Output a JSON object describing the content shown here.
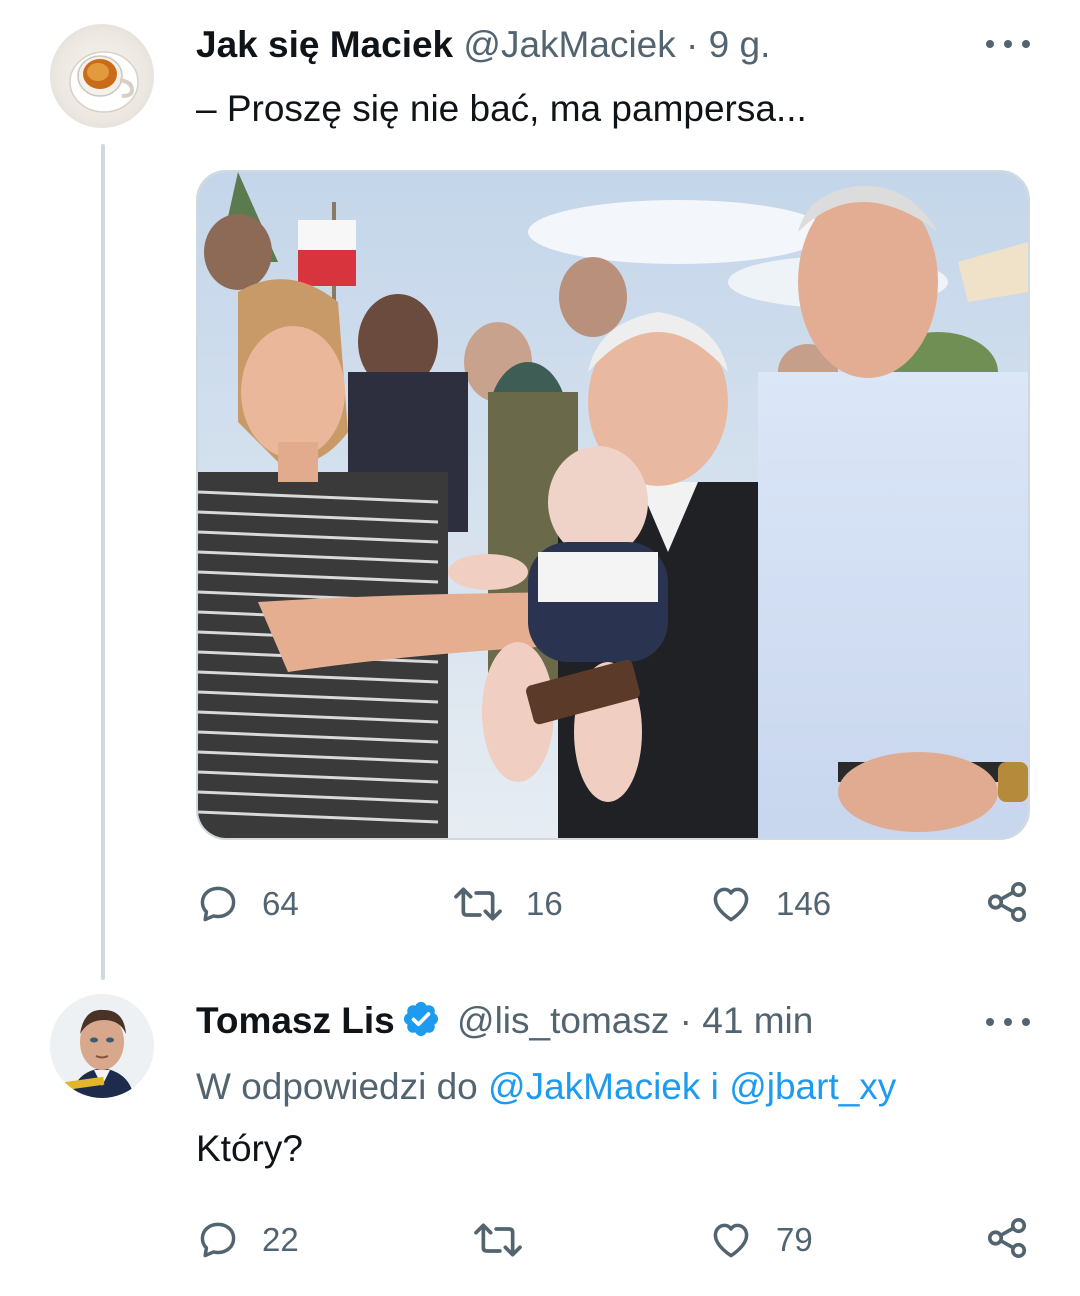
{
  "tweets": [
    {
      "author": {
        "display_name": "Jak się Maciek",
        "handle": "@JakMaciek",
        "separator": "·",
        "time": "9 g."
      },
      "text": "– Proszę się nie bać, ma pampersa...",
      "actions": {
        "replies": "64",
        "retweets": "16",
        "likes": "146"
      }
    },
    {
      "author": {
        "display_name": "Tomasz Lis",
        "handle": "@lis_tomasz",
        "separator": "·",
        "time": "41 min",
        "verified": true
      },
      "reply_to": {
        "prefix": "W odpowiedzi do",
        "mention_1": "@JakMaciek",
        "joiner": "i",
        "mention_2": "@jbart_xy"
      },
      "text": "Który?",
      "actions": {
        "replies": "22",
        "retweets": "",
        "likes": "79"
      }
    }
  ],
  "colors": {
    "text_primary": "#0f1419",
    "text_secondary": "#536471",
    "link": "#1d9bf0",
    "thread_line": "#cfd9de",
    "verified": "#1d9bf0"
  },
  "icons": [
    "more-icon",
    "reply-icon",
    "retweet-icon",
    "like-icon",
    "share-icon",
    "verified-badge-icon"
  ]
}
